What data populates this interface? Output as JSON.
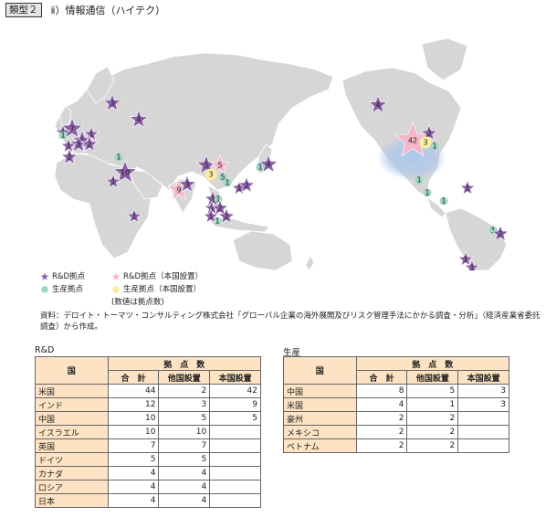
{
  "header": {
    "type_badge": "類型２",
    "title": "ⅱ）情報通信（ハイテク）"
  },
  "legend": {
    "rd": "R&D拠点",
    "rd_home": "R&D拠点（本国設置）",
    "prod": "生産拠点",
    "prod_home": "生産拠点（本国設置）",
    "note": "(数値は拠点数)"
  },
  "colors": {
    "rd": "#8a5ea8",
    "rd_home": "#f4b6c8",
    "prod": "#9fd6c6",
    "prod_home": "#f7eea0",
    "land": "#d6d6d6",
    "header_fill": "#fde3c4",
    "glow": "#a9c6ee"
  },
  "source_text": "資料：デロイト・トーマツ・コンサルティング株式会社「グローバル企業の海外展開及びリスク管理手法にかかる調査・分析」（経済産業省委託調査）から作成。",
  "markers": [
    {
      "type": "rd",
      "label": "3"
    },
    {
      "type": "rd",
      "label": "4"
    },
    {
      "type": "rd",
      "label": "7"
    },
    {
      "type": "rd",
      "label": "1"
    },
    {
      "type": "rd",
      "label": "5"
    },
    {
      "type": "rd",
      "label": "1"
    },
    {
      "type": "rd",
      "label": "3"
    },
    {
      "type": "rd",
      "label": "2"
    },
    {
      "type": "rd",
      "label": "1"
    },
    {
      "type": "prod",
      "label": "1"
    },
    {
      "type": "rd",
      "label": "2"
    },
    {
      "type": "prod",
      "label": "1"
    },
    {
      "type": "rd",
      "label": "10"
    },
    {
      "type": "rd",
      "label": "1"
    },
    {
      "type": "rd",
      "label": "1"
    },
    {
      "type": "rd",
      "label": "5"
    },
    {
      "type": "rd_home",
      "label": "5"
    },
    {
      "type": "prod_home",
      "label": "3"
    },
    {
      "type": "prod",
      "label": "5"
    },
    {
      "type": "prod",
      "label": "1"
    },
    {
      "type": "rd_home",
      "label": "9"
    },
    {
      "type": "rd",
      "label": "3"
    },
    {
      "type": "rd",
      "label": "1"
    },
    {
      "type": "rd",
      "label": "2"
    },
    {
      "type": "prod",
      "label": "1"
    },
    {
      "type": "rd",
      "label": "4"
    },
    {
      "type": "rd",
      "label": "2"
    },
    {
      "type": "prod",
      "label": "1"
    },
    {
      "type": "rd",
      "label": "1"
    },
    {
      "type": "rd",
      "label": "2"
    },
    {
      "type": "prod",
      "label": "1"
    },
    {
      "type": "rd",
      "label": "2"
    },
    {
      "type": "rd",
      "label": "1"
    },
    {
      "type": "rd",
      "label": "4"
    },
    {
      "type": "rd_home",
      "label": "42"
    },
    {
      "type": "rd",
      "label": "2"
    },
    {
      "type": "prod_home",
      "label": "3"
    },
    {
      "type": "prod",
      "label": "1"
    },
    {
      "type": "prod",
      "label": "1"
    },
    {
      "type": "prod",
      "label": "1"
    },
    {
      "type": "prod",
      "label": "1"
    },
    {
      "type": "rd",
      "label": "1"
    },
    {
      "type": "prod",
      "label": "1"
    },
    {
      "type": "rd",
      "label": "2"
    },
    {
      "type": "rd",
      "label": "1"
    },
    {
      "type": "rd",
      "label": "1"
    }
  ],
  "rd_table": {
    "title": "R&D",
    "col_country": "国",
    "group_header": "拠　点　数",
    "cols": [
      "合　計",
      "他国設置",
      "本国設置"
    ],
    "rows": [
      [
        "米国",
        "44",
        "2",
        "42"
      ],
      [
        "インド",
        "12",
        "3",
        "9"
      ],
      [
        "中国",
        "10",
        "5",
        "5"
      ],
      [
        "イスラエル",
        "10",
        "10",
        ""
      ],
      [
        "英国",
        "7",
        "7",
        ""
      ],
      [
        "ドイツ",
        "5",
        "5",
        ""
      ],
      [
        "カナダ",
        "4",
        "4",
        ""
      ],
      [
        "ロシア",
        "4",
        "4",
        ""
      ],
      [
        "日本",
        "4",
        "4",
        ""
      ]
    ]
  },
  "prod_table": {
    "title": "生産",
    "col_country": "国",
    "group_header": "拠　点　数",
    "cols": [
      "合　計",
      "他国設置",
      "本国設置"
    ],
    "rows": [
      [
        "中国",
        "8",
        "5",
        "3"
      ],
      [
        "米国",
        "4",
        "1",
        "3"
      ],
      [
        "豪州",
        "2",
        "2",
        ""
      ],
      [
        "メキシコ",
        "2",
        "2",
        ""
      ],
      [
        "ベトナム",
        "2",
        "2",
        ""
      ]
    ]
  }
}
